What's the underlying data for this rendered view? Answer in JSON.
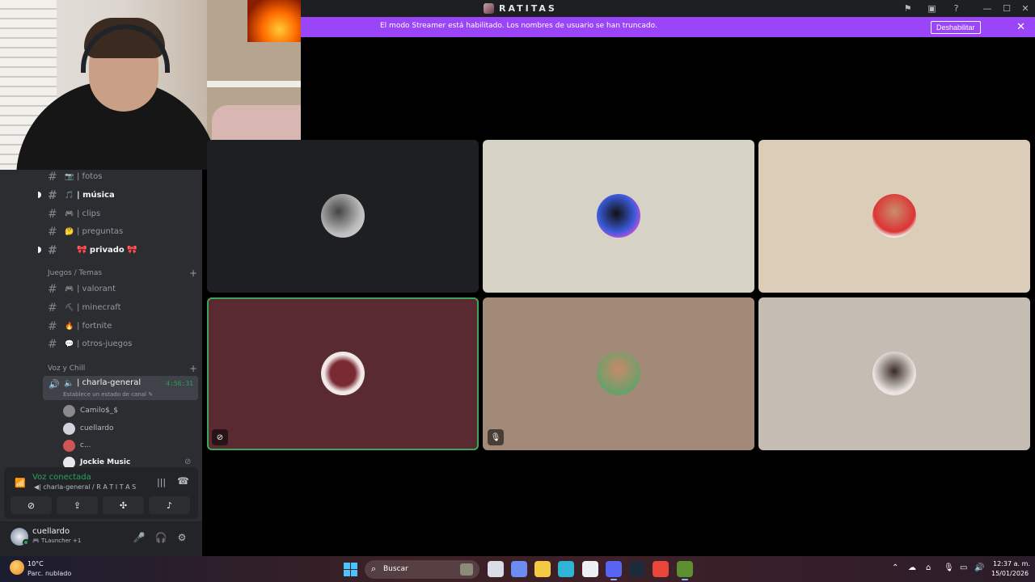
{
  "app": {
    "server_name": "RATITAS"
  },
  "banner": {
    "text": "El modo Streamer está habilitado. Los nombres de usuario se han truncado.",
    "button_label": "Deshabilitar",
    "close_glyph": "✕",
    "color": "#9b45f8"
  },
  "titlebar_icons": [
    "inbox-icon",
    "screen-icon",
    "help-icon"
  ],
  "window_controls": [
    "minimize-icon",
    "maximize-icon",
    "close-icon"
  ],
  "sidebar": {
    "channels_top": [
      {
        "name": "| fotos",
        "emoji": "📷",
        "bold": false,
        "unread": false
      },
      {
        "name": "| música",
        "emoji": "🎵",
        "bold": true,
        "unread": true
      },
      {
        "name": "| clips",
        "emoji": "🎮",
        "bold": false,
        "unread": false
      },
      {
        "name": "| preguntas",
        "emoji": "🤔",
        "bold": false,
        "unread": false
      },
      {
        "name": "🎀 privado 🎀",
        "emoji": "",
        "bold": true,
        "unread": true
      }
    ],
    "category_games": "Juegos / Temas",
    "channels_games": [
      {
        "name": "| valorant",
        "emoji": "🎮"
      },
      {
        "name": "| minecraft",
        "emoji": "⛏"
      },
      {
        "name": "| fortnite",
        "emoji": "🔥"
      },
      {
        "name": "| otros-juegos",
        "emoji": "💬"
      }
    ],
    "category_voice": "Voz y Chill",
    "voice_channel": {
      "name": "| charla-general",
      "timer": "4:56:31",
      "status_placeholder": "Establece un estado de canal ✎"
    },
    "voice_users": [
      {
        "name": "Camilo$_$",
        "bold": false,
        "color": "#8a8a8a"
      },
      {
        "name": "cuellardo",
        "bold": false,
        "color": "#cfd4dc"
      },
      {
        "name": "c...",
        "bold": false,
        "color": "#c55"
      },
      {
        "name": "Jockie Music",
        "bold": true,
        "color": "#e8e8e8"
      }
    ]
  },
  "voice_panel": {
    "status": "Voz conectada",
    "channel": "◀| charla-general / R A T I T A S",
    "buttons": [
      "camera-off-icon",
      "screen-share-icon",
      "activities-icon",
      "soundboard-icon"
    ]
  },
  "user_panel": {
    "username": "cuellardo",
    "activity": "🎮 TLauncher +1",
    "controls": [
      "microphone-icon",
      "headphones-icon",
      "settings-icon"
    ]
  },
  "video_tiles": [
    {
      "bg": "#1e1f22",
      "avatar": "radial-gradient(circle at 40% 40%,#444,#bbb 60%,#ddd)",
      "speaking": false,
      "icon": ""
    },
    {
      "bg": "#d6d2c6",
      "avatar": "radial-gradient(circle at 45% 45%,#111,#3b5bdb 55%,#c34fd8 75%,#ffd)",
      "speaking": false,
      "icon": ""
    },
    {
      "bg": "#dccdb8",
      "avatar": "radial-gradient(circle at 50% 40%,#c98e6e,#d33 60%,#eee 75%)",
      "speaking": false,
      "icon": ""
    },
    {
      "bg": "#5a2a31",
      "avatar": "radial-gradient(circle at 50% 50%,#7a2a33 40%,#f2e8e8 60%)",
      "speaking": true,
      "icon": "⊘"
    },
    {
      "bg": "#a38a78",
      "avatar": "radial-gradient(circle at 50% 40%,#c78a6a,#6aa06a 70%)",
      "speaking": false,
      "icon": "🎙"
    },
    {
      "bg": "#c5bcb4",
      "avatar": "radial-gradient(circle at 50% 45%,#3a2a25,#e9e4df 65%)",
      "speaking": false,
      "icon": ""
    }
  ],
  "taskbar": {
    "weather_temp": "10°C",
    "weather_cond": "Parc. nublado",
    "search_label": "Buscar",
    "clock_time": "12:37 a. m.",
    "clock_date": "15/01/2026",
    "apps": [
      {
        "name": "task-view-icon",
        "color": "#d8dde6"
      },
      {
        "name": "copilot-icon",
        "color": "#6d8cf2"
      },
      {
        "name": "file-explorer-icon",
        "color": "#f3c842"
      },
      {
        "name": "edge-icon",
        "color": "#2fb3d6"
      },
      {
        "name": "store-icon",
        "color": "#ecf0f4"
      },
      {
        "name": "discord-icon",
        "color": "#5865f2"
      },
      {
        "name": "steam-icon",
        "color": "#1e2a3a"
      },
      {
        "name": "chrome-icon",
        "color": "#e8453c"
      },
      {
        "name": "minecraft-icon",
        "color": "#5c8f2f"
      }
    ],
    "tray": [
      "chevron-up-icon",
      "onedrive-icon",
      "network-icon",
      "mic-icon",
      "display-icon",
      "volume-icon"
    ]
  }
}
